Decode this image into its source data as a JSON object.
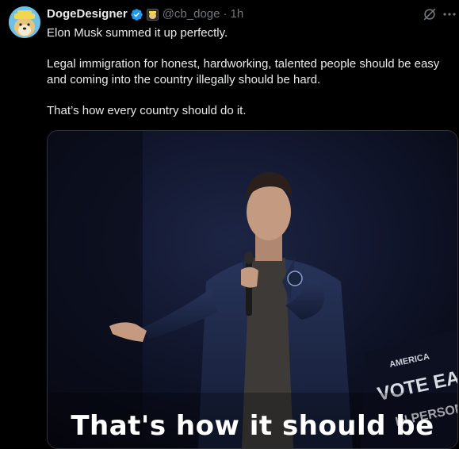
{
  "author": {
    "display_name": "DogeDesigner",
    "handle": "@cb_doge",
    "separator": "·",
    "time": "1h"
  },
  "tweet": {
    "paragraphs": [
      "Elon Musk summed it up perfectly.",
      "Legal immigration for honest, hardworking, talented people should be easy and coming into the country illegally should be hard.",
      "That’s how every country should do it."
    ]
  },
  "media": {
    "caption": "That's how it should be",
    "sign_top": "AMERICA",
    "sign_main": "VOTE EARLY",
    "sign_sub": "IN PERSON"
  },
  "icons": {
    "verified": "verified-badge-icon",
    "affiliate": "affiliate-badge-icon",
    "grok": "grok-icon",
    "more": "more-icon"
  },
  "colors": {
    "background": "#000000",
    "text": "#e7e9ea",
    "secondary": "#71767b",
    "verified": "#1d9bf0"
  }
}
